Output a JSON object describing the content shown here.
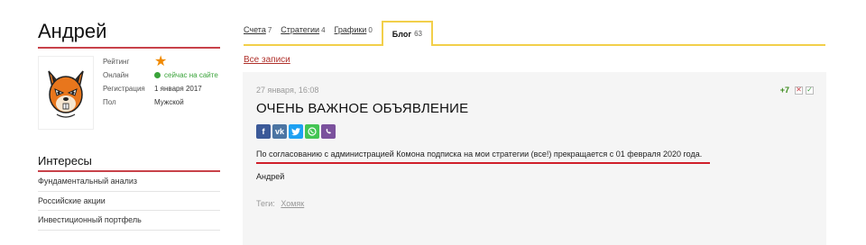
{
  "profile": {
    "name": "Андрей",
    "stats": [
      {
        "label": "Рейтинг",
        "value": ""
      },
      {
        "label": "Онлайн",
        "value": "сейчас на сайте"
      },
      {
        "label": "Регистрация",
        "value": "1 января 2017"
      },
      {
        "label": "Пол",
        "value": "Мужской"
      }
    ]
  },
  "interests": {
    "title": "Интересы",
    "items": [
      "Фундаментальный анализ",
      "Российские акции",
      "Инвестиционный портфель"
    ]
  },
  "tabs": [
    {
      "label": "Счета",
      "count": "7"
    },
    {
      "label": "Стратегии",
      "count": "4"
    },
    {
      "label": "Графики",
      "count": "0"
    },
    {
      "label": "Блог",
      "count": "63",
      "active": true
    }
  ],
  "all_posts_link": "Все записи",
  "post": {
    "date": "27 января, 16:08",
    "rating": "+7",
    "title": "ОЧЕНЬ ВАЖНОЕ ОБЪЯВЛЕНИЕ",
    "body": "По согласованию с администрацией Комона подписка на мои стратегии (все!) прекращается с 01 февраля 2020 года.",
    "author": "Андрей",
    "tags_label": "Теги:",
    "tag": "Хомяк"
  },
  "share_buttons": [
    {
      "icon": "facebook-icon",
      "glyph": "f",
      "color": "#3b5998"
    },
    {
      "icon": "vk-icon",
      "glyph": "vk",
      "color": "#4c75a3"
    },
    {
      "icon": "twitter-icon",
      "glyph": "t",
      "color": "#1da1f2"
    },
    {
      "icon": "whatsapp-icon",
      "glyph": "✆",
      "color": "#43c553"
    },
    {
      "icon": "viber-icon",
      "glyph": "✆",
      "color": "#7b519d"
    }
  ],
  "colors": {
    "accent_red": "#c8424a",
    "tab_yellow": "#f2cf4a",
    "online_green": "#3aa33a",
    "rating_star": "#f08a00"
  }
}
